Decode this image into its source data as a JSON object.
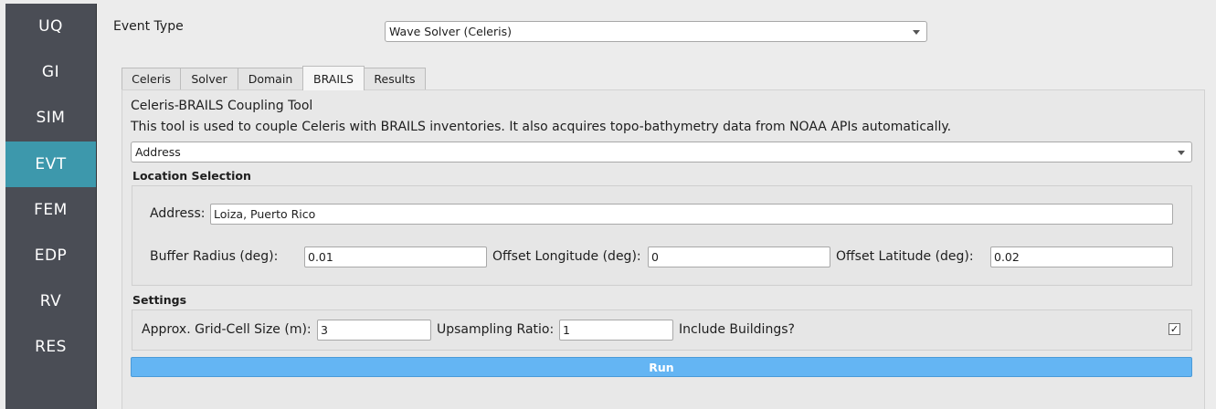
{
  "sidebar": {
    "items": [
      {
        "label": "UQ"
      },
      {
        "label": "GI"
      },
      {
        "label": "SIM"
      },
      {
        "label": "EVT"
      },
      {
        "label": "FEM"
      },
      {
        "label": "EDP"
      },
      {
        "label": "RV"
      },
      {
        "label": "RES"
      }
    ],
    "active": "EVT",
    "colors": {
      "background": "#4a4d55",
      "active": "#3d98ac"
    }
  },
  "event_type": {
    "label": "Event Type",
    "selected": "Wave Solver (Celeris)"
  },
  "tabs": [
    {
      "label": "Celeris"
    },
    {
      "label": "Solver"
    },
    {
      "label": "Domain"
    },
    {
      "label": "BRAILS"
    },
    {
      "label": "Results"
    }
  ],
  "active_tab": "BRAILS",
  "brails": {
    "title": "Celeris-BRAILS Coupling Tool",
    "description": "This tool is used to couple Celeris with BRAILS inventories. It also acquires topo-bathymetry data from NOAA APIs automatically.",
    "mode_selected": "Address",
    "location": {
      "title": "Location Selection",
      "address_label": "Address:",
      "address_value": "Loiza, Puerto Rico",
      "buffer_label": "Buffer Radius (deg):",
      "buffer_value": "0.01",
      "offset_lon_label": "Offset Longitude (deg):",
      "offset_lon_value": "0",
      "offset_lat_label": "Offset Latitude (deg):",
      "offset_lat_value": "0.02"
    },
    "settings": {
      "title": "Settings",
      "grid_label": "Approx. Grid-Cell Size (m):",
      "grid_value": "3",
      "upsampling_label": "Upsampling Ratio:",
      "upsampling_value": "1",
      "include_buildings_label": "Include Buildings?",
      "include_buildings_checked": true,
      "check_glyph": "✓"
    },
    "run_label": "Run",
    "run_color": "#64b5f3"
  }
}
